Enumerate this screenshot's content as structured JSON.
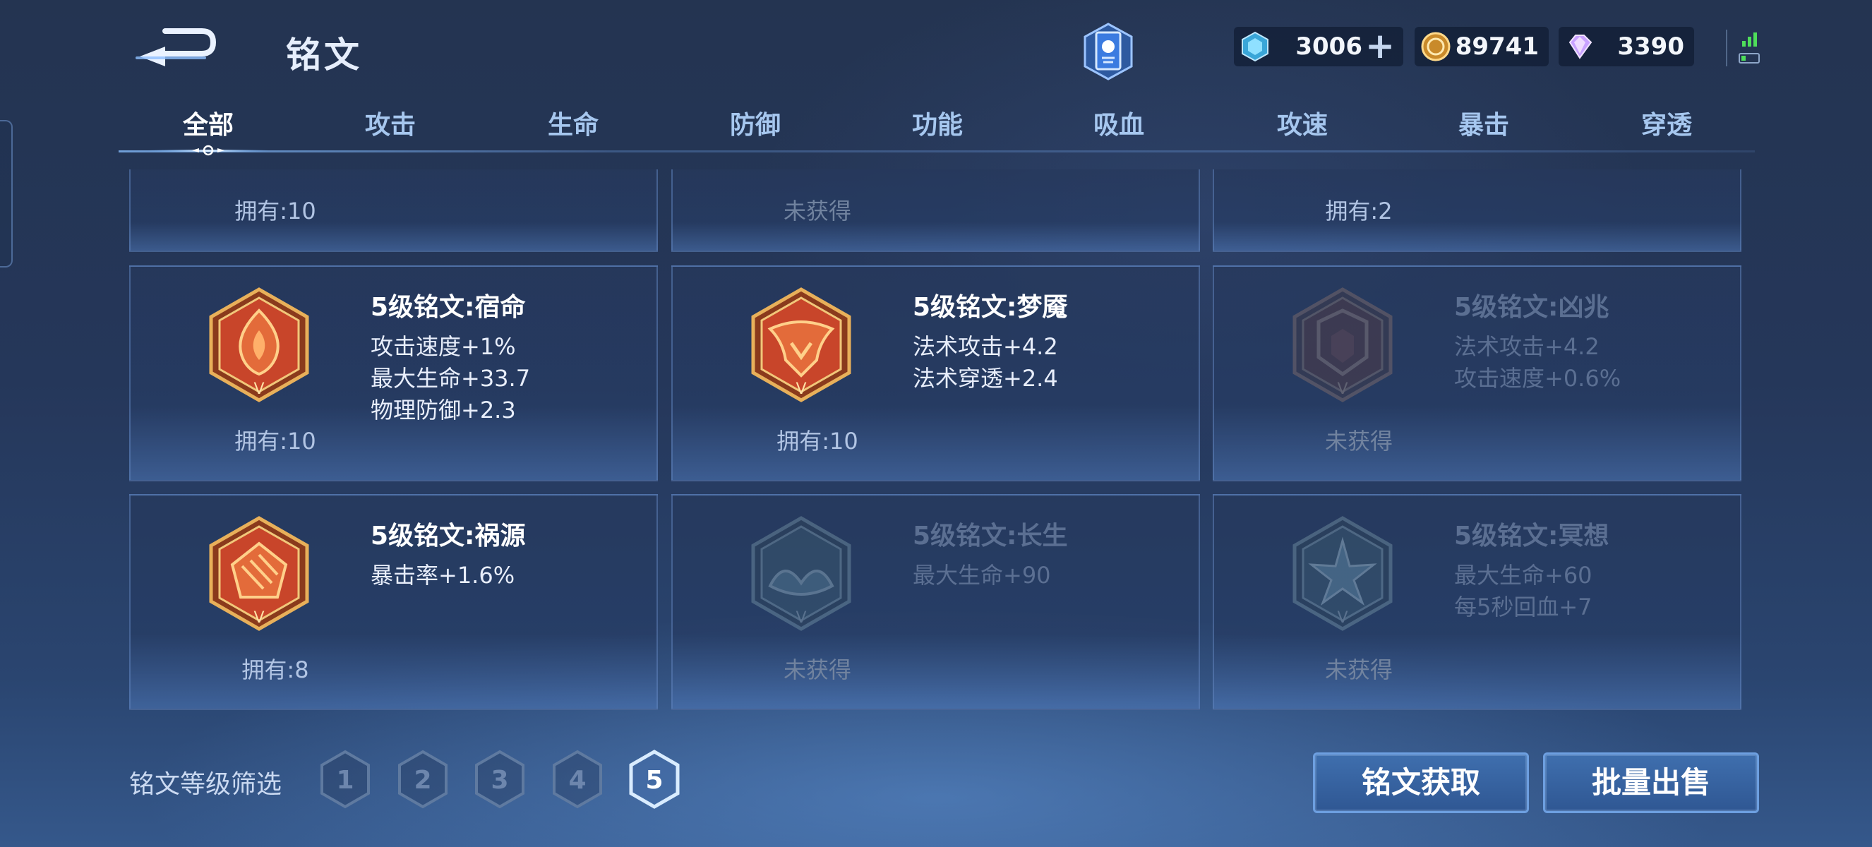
{
  "header": {
    "title": "铭文",
    "currencies": [
      {
        "icon": "diamond-icon",
        "value": "3006",
        "plus": "+"
      },
      {
        "icon": "gold-coin-icon",
        "value": "89741"
      },
      {
        "icon": "gem-icon",
        "value": "3390"
      }
    ]
  },
  "tabs": [
    {
      "label": "全部",
      "active": true
    },
    {
      "label": "攻击"
    },
    {
      "label": "生命"
    },
    {
      "label": "防御"
    },
    {
      "label": "功能"
    },
    {
      "label": "吸血"
    },
    {
      "label": "攻速"
    },
    {
      "label": "暴击"
    },
    {
      "label": "穿透"
    }
  ],
  "top_row": [
    {
      "owned": "拥有:10"
    },
    {
      "owned": "未获得"
    },
    {
      "owned": "拥有:2"
    }
  ],
  "inscriptions": [
    {
      "name": "5级铭文:宿命",
      "attrs": [
        "攻击速度+1%",
        "最大生命+33.7",
        "物理防御+2.3"
      ],
      "owned": "拥有:10",
      "locked": false
    },
    {
      "name": "5级铭文:梦魇",
      "attrs": [
        "法术攻击+4.2",
        "法术穿透+2.4"
      ],
      "owned": "拥有:10",
      "locked": false
    },
    {
      "name": "5级铭文:凶兆",
      "attrs": [
        "法术攻击+4.2",
        "攻击速度+0.6%"
      ],
      "owned": "未获得",
      "locked": true
    },
    {
      "name": "5级铭文:祸源",
      "attrs": [
        "暴击率+1.6%"
      ],
      "owned": "拥有:8",
      "locked": false
    },
    {
      "name": "5级铭文:长生",
      "attrs": [
        "最大生命+90"
      ],
      "owned": "未获得",
      "locked": true
    },
    {
      "name": "5级铭文:冥想",
      "attrs": [
        "最大生命+60",
        "每5秒回血+7"
      ],
      "owned": "未获得",
      "locked": true
    }
  ],
  "filter": {
    "label": "铭文等级筛选",
    "levels": [
      "1",
      "2",
      "3",
      "4",
      "5"
    ],
    "selected": "5"
  },
  "buttons": {
    "acquire": "铭文获取",
    "bulk_sell": "批量出售"
  },
  "colors": {
    "accent": "#6d9fe0",
    "emblem_red": "#c8452a",
    "emblem_gold": "#e0a54a",
    "locked_text": "#5b6f92"
  }
}
